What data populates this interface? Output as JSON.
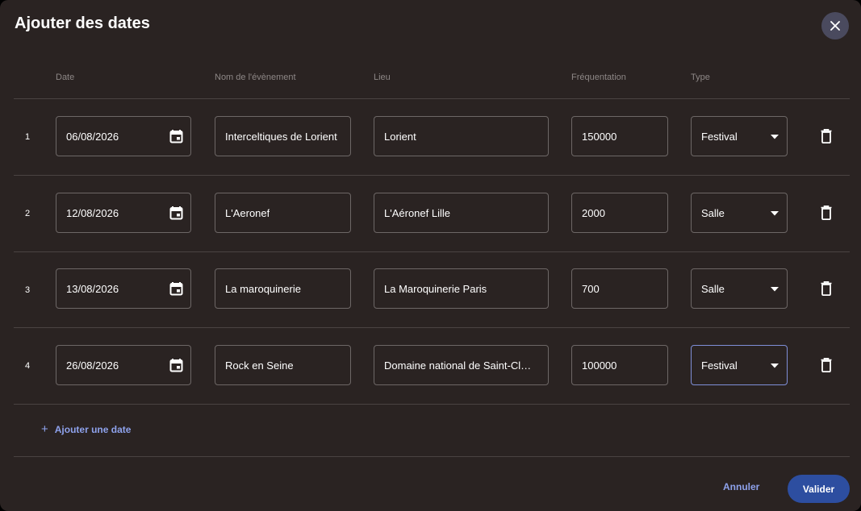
{
  "dialog": {
    "title": "Ajouter des dates",
    "close_icon": "close-icon"
  },
  "columns": {
    "date": "Date",
    "name": "Nom de l'évènement",
    "place": "Lieu",
    "attendance": "Fréquentation",
    "type": "Type"
  },
  "rows": [
    {
      "num": "1",
      "date": "06/08/2026",
      "name": "Interceltiques de Lorient",
      "place": "Lorient",
      "attendance": "150000",
      "type": "Festival"
    },
    {
      "num": "2",
      "date": "12/08/2026",
      "name": "L'Aeronef",
      "place": "L'Aéronef Lille",
      "attendance": "2000",
      "type": "Salle"
    },
    {
      "num": "3",
      "date": "13/08/2026",
      "name": "La maroquinerie",
      "place": "La Maroquinerie Paris",
      "attendance": "700",
      "type": "Salle"
    },
    {
      "num": "4",
      "date": "26/08/2026",
      "name": "Rock en Seine",
      "place": "Domaine national de Saint-Cloud",
      "attendance": "100000",
      "type": "Festival"
    }
  ],
  "icons": {
    "calendar": "calendar-icon",
    "dropdown": "chevron-down-icon",
    "delete": "trash-icon",
    "add": "plus-icon"
  },
  "actions": {
    "add_date": "Ajouter une date",
    "cancel": "Annuler",
    "confirm": "Valider"
  },
  "colors": {
    "background": "#2a2322",
    "accent": "#8ea2ec",
    "primary_button": "#2d4ea0",
    "focus_border": "#7f8fd8"
  }
}
